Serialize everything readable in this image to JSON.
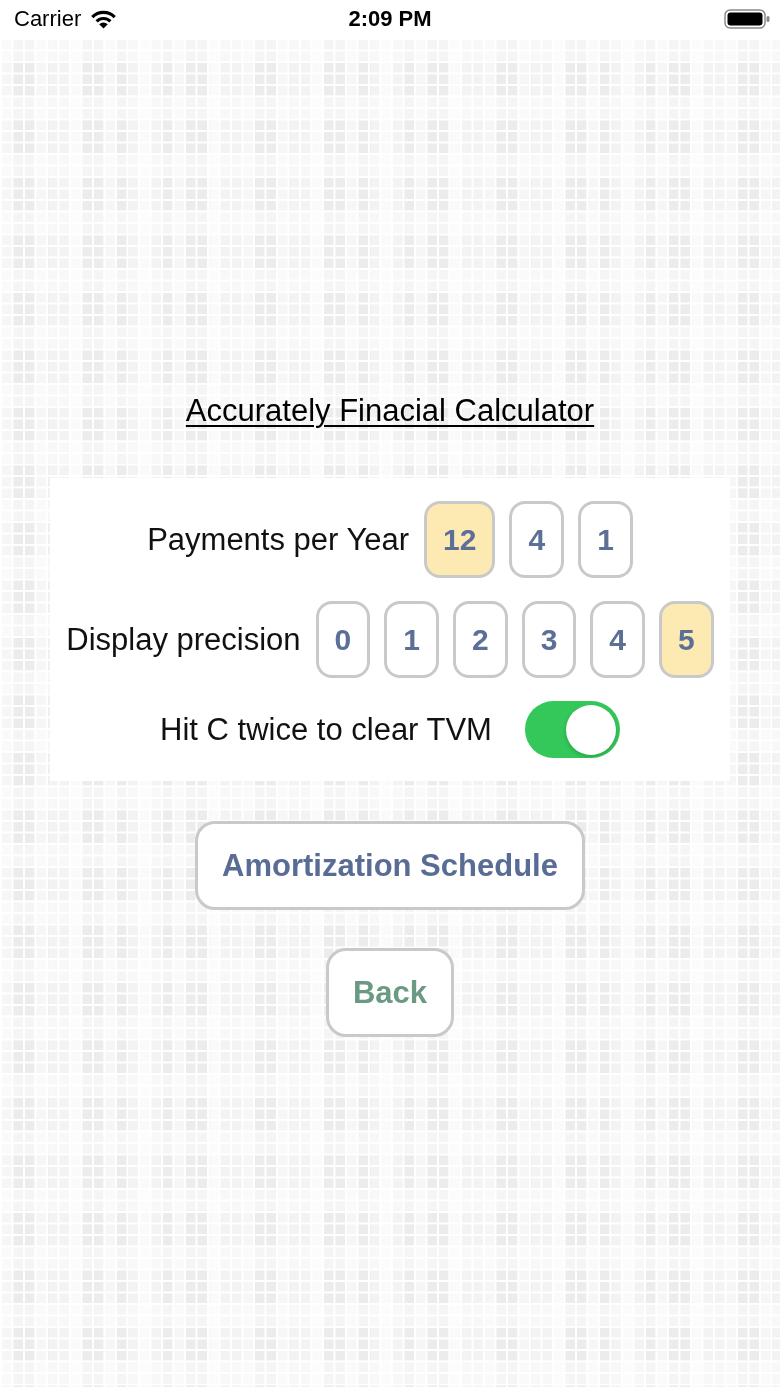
{
  "status_bar": {
    "carrier": "Carrier",
    "time": "2:09 PM"
  },
  "title": "Accurately Finacial Calculator",
  "settings": [
    {
      "kind": "choice",
      "label": "Payments per Year",
      "options": [
        {
          "label": "12",
          "selected": true
        },
        {
          "label": "4",
          "selected": false
        },
        {
          "label": "1",
          "selected": false
        }
      ]
    },
    {
      "kind": "choice",
      "label": "Display precision",
      "options": [
        {
          "label": "0",
          "selected": false
        },
        {
          "label": "1",
          "selected": false
        },
        {
          "label": "2",
          "selected": false
        },
        {
          "label": "3",
          "selected": false
        },
        {
          "label": "4",
          "selected": false
        },
        {
          "label": "5",
          "selected": true
        }
      ]
    },
    {
      "kind": "toggle",
      "label": "Hit C twice to clear TVM",
      "on": true
    }
  ],
  "buttons": [
    {
      "label": "Amortization Schedule",
      "color": "#586c94"
    },
    {
      "label": "Back",
      "color": "#6b9a82"
    }
  ]
}
